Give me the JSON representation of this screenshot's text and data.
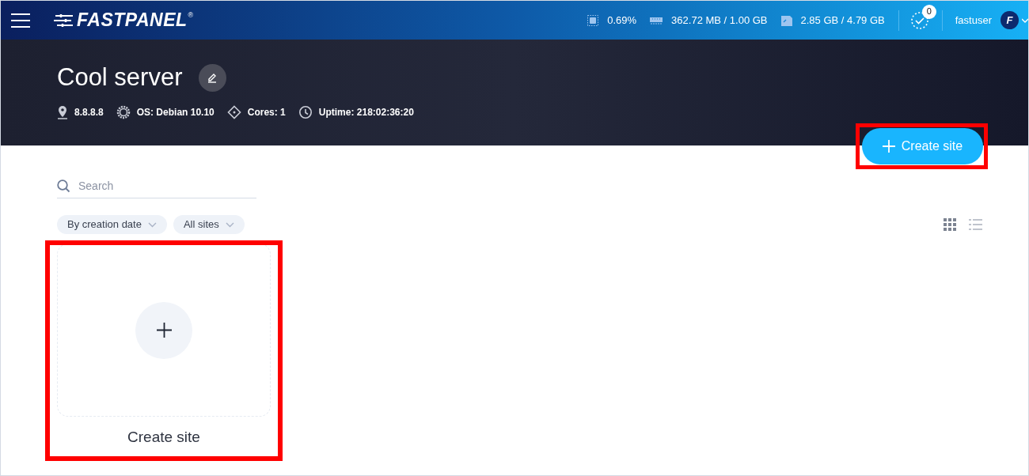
{
  "header": {
    "logo": "FASTPANEL",
    "logo_mark": "®",
    "stats": [
      {
        "kind": "cpu",
        "value": "0.69%"
      },
      {
        "kind": "ram",
        "value": "362.72 MB / 1.00 GB"
      },
      {
        "kind": "disk",
        "value": "2.85 GB / 4.79 GB"
      }
    ],
    "tasks_badge": "0",
    "user": "fastuser",
    "avatar_letter": "F"
  },
  "server": {
    "name": "Cool server",
    "details": [
      {
        "kind": "ip",
        "text": "8.8.8.8"
      },
      {
        "kind": "os",
        "text": "OS: Debian 10.10"
      },
      {
        "kind": "cores",
        "text": "Cores: 1"
      },
      {
        "kind": "uptime",
        "text": "Uptime: 218:02:36:20"
      }
    ]
  },
  "create_button": "Create site",
  "search": {
    "placeholder": "Search"
  },
  "filters": [
    "By creation date",
    "All sites"
  ],
  "views": [
    {
      "kind": "grid",
      "selected": true
    },
    {
      "kind": "list",
      "selected": false
    }
  ],
  "create_card": {
    "label": "Create site"
  }
}
